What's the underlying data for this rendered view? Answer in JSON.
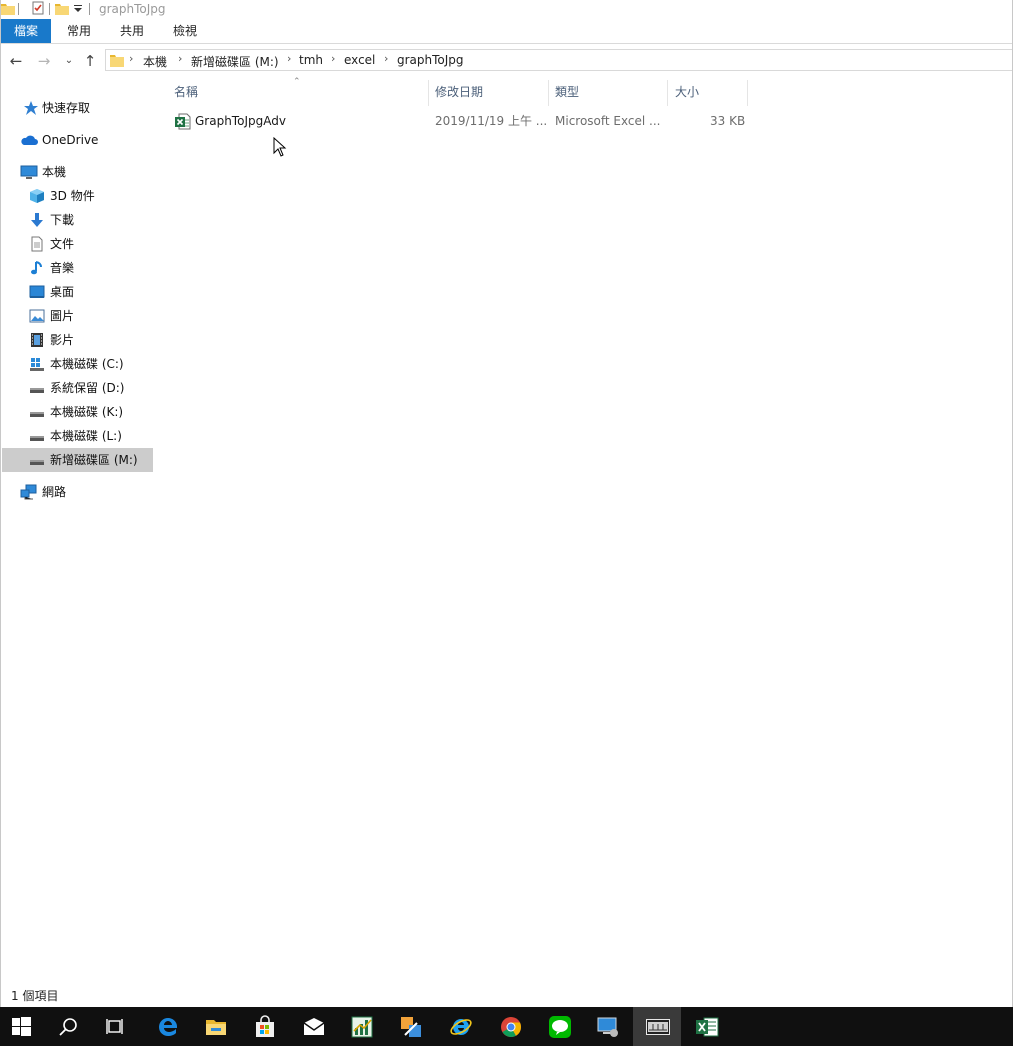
{
  "window": {
    "title": "graphToJpg"
  },
  "ribbon": {
    "tabs": [
      "檔案",
      "常用",
      "共用",
      "檢視"
    ]
  },
  "address": {
    "crumbs": [
      "本機",
      "新增磁碟區 (M:)",
      "tmh",
      "excel",
      "graphToJpg"
    ]
  },
  "nav": {
    "quick_access": "快速存取",
    "onedrive": "OneDrive",
    "this_pc": "本機",
    "pc_items": [
      "3D 物件",
      "下載",
      "文件",
      "音樂",
      "桌面",
      "圖片",
      "影片"
    ],
    "drives": [
      "本機磁碟 (C:)",
      "系統保留 (D:)",
      "本機磁碟 (K:)",
      "本機磁碟 (L:)",
      "新增磁碟區 (M:)"
    ],
    "selected_drive": "新增磁碟區 (M:)",
    "network": "網路"
  },
  "columns": {
    "name": "名稱",
    "date": "修改日期",
    "type": "類型",
    "size": "大小"
  },
  "files": [
    {
      "name": "GraphToJpgAdv",
      "date": "2019/11/19 上午 ...",
      "type": "Microsoft Excel ...",
      "size": "33 KB",
      "icon": "excel-file-icon"
    }
  ],
  "status": {
    "item_count": "1 個項目"
  },
  "taskbar": {
    "items": [
      "windows-start",
      "search",
      "task-view",
      "edge",
      "file-explorer",
      "store",
      "mail",
      "excel-chart-app",
      "paint-tool",
      "internet-explorer",
      "chrome",
      "line",
      "remote-desktop",
      "ggg-app",
      "excel"
    ],
    "active": "ggg-app"
  },
  "colors": {
    "accent": "#1979ca",
    "selected_nav": "#cccccc",
    "taskbar": "#101010",
    "column_header": "#4c607a"
  }
}
